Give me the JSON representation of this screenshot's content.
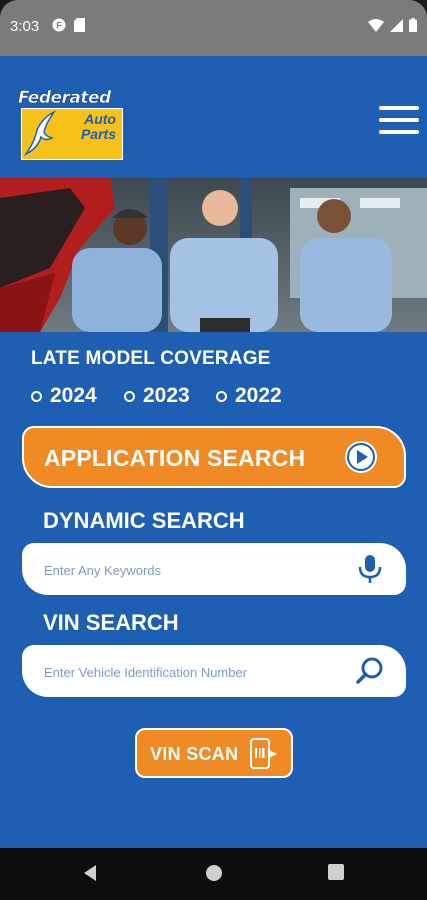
{
  "status_bar": {
    "time": "3:03",
    "left_icons": [
      "app-notification-icon",
      "sd-card-icon"
    ],
    "right_icons": [
      "wifi-icon",
      "signal-icon",
      "battery-icon"
    ]
  },
  "header": {
    "logo_line1": "Federated",
    "logo_line2": "Auto",
    "logo_line3": "Parts",
    "menu_icon": "hamburger-menu-icon"
  },
  "coverage": {
    "title": "LATE MODEL COVERAGE",
    "years": [
      "2024",
      "2023",
      "2022"
    ]
  },
  "application_search": {
    "label": "APPLICATION SEARCH"
  },
  "dynamic_search": {
    "title": "DYNAMIC SEARCH",
    "placeholder": "Enter Any Keywords",
    "value": ""
  },
  "vin_search": {
    "title": "VIN SEARCH",
    "placeholder": "Enter Vehicle Identification Number",
    "value": ""
  },
  "vin_scan": {
    "label": "VIN SCAN"
  },
  "colors": {
    "brand_blue": "#1e5fb3",
    "accent_orange": "#f08a24",
    "logo_yellow": "#f6c21a"
  }
}
